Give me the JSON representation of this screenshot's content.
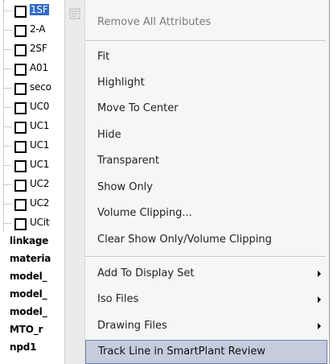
{
  "tree": {
    "checkbox_nodes": [
      {
        "label": "1SF",
        "selected": true
      },
      {
        "label": "2-A",
        "selected": false
      },
      {
        "label": "2SF",
        "selected": false
      },
      {
        "label": "A01",
        "selected": false
      },
      {
        "label": "seco",
        "selected": false
      },
      {
        "label": "UC0",
        "selected": false
      },
      {
        "label": "UC1",
        "selected": false
      },
      {
        "label": "UC1",
        "selected": false
      },
      {
        "label": "UC1",
        "selected": false
      },
      {
        "label": "UC2",
        "selected": false
      },
      {
        "label": "UC2",
        "selected": false
      },
      {
        "label": "UCit",
        "selected": false
      }
    ],
    "bold_nodes": [
      "linkage",
      "materia",
      "model_",
      "model_",
      "model_",
      "MTO_r",
      "npd1"
    ]
  },
  "menu": {
    "remove_all_attributes": "Remove All Attributes",
    "items": [
      "Fit",
      "Highlight",
      "Move To Center",
      "Hide",
      "Transparent",
      "Show Only",
      "Volume Clipping...",
      "Clear Show Only/Volume Clipping"
    ],
    "submenus": [
      "Add To Display Set",
      "Iso Files",
      "Drawing Files"
    ],
    "track_line": "Track Line in SmartPlant Review"
  },
  "colors": {
    "selection": "#316ac5",
    "menu_highlight": "#c4ccde",
    "menu_highlight_border": "#6f7fa8"
  }
}
